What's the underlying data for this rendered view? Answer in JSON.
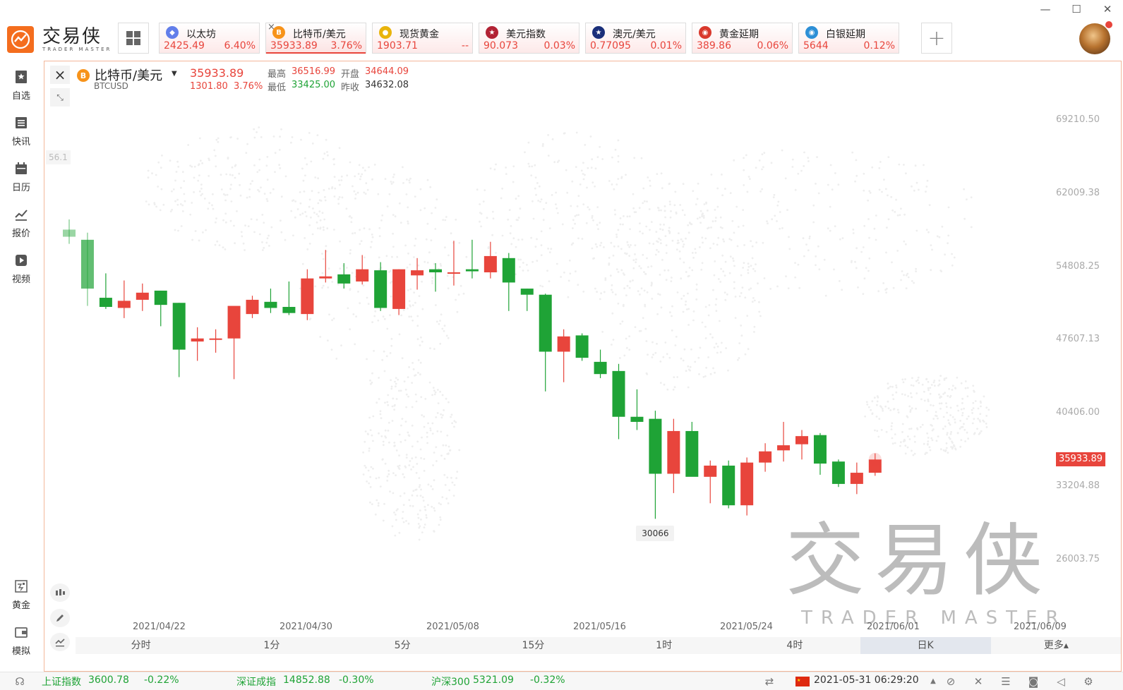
{
  "app": {
    "name_cn": "交易侠",
    "name_en": "TRADER MASTER"
  },
  "window": {
    "minimize": "—",
    "maximize": "☐",
    "close": "✕"
  },
  "quote_tabs": [
    {
      "name": "以太坊",
      "price": "2425.49",
      "change": "6.40%",
      "icon": "ethereum-icon",
      "color": "#627eea",
      "glyph": "◆"
    },
    {
      "name": "比特币/美元",
      "price": "35933.89",
      "change": "3.76%",
      "icon": "bitcoin-icon",
      "color": "#f7931a",
      "glyph": "B",
      "active": true
    },
    {
      "name": "现货黄金",
      "price": "1903.71",
      "change": "--",
      "icon": "gold-icon",
      "color": "#e9b40c",
      "glyph": "●"
    },
    {
      "name": "美元指数",
      "price": "90.073",
      "change": "0.03%",
      "icon": "us-flag-icon",
      "color": "#b22234",
      "glyph": "★"
    },
    {
      "name": "澳元/美元",
      "price": "0.77095",
      "change": "0.01%",
      "icon": "au-flag-icon",
      "color": "#1a2f7a",
      "glyph": "★"
    },
    {
      "name": "黄金延期",
      "price": "389.86",
      "change": "0.06%",
      "icon": "gold-deferred-icon",
      "color": "#d9382c",
      "glyph": "◉"
    },
    {
      "name": "白银延期",
      "price": "5644",
      "change": "0.12%",
      "icon": "silver-deferred-icon",
      "color": "#2d8fd6",
      "glyph": "◉"
    }
  ],
  "sidebar": {
    "items": [
      {
        "label": "自选",
        "icon": "watchlist-icon"
      },
      {
        "label": "快讯",
        "icon": "news-icon"
      },
      {
        "label": "日历",
        "icon": "calendar-icon"
      },
      {
        "label": "报价",
        "icon": "quotes-icon"
      },
      {
        "label": "视频",
        "icon": "video-icon"
      }
    ],
    "bottom_items": [
      {
        "label": "黄金",
        "icon": "gold-tool-icon"
      },
      {
        "label": "模拟",
        "icon": "simulate-icon"
      }
    ]
  },
  "symbol": {
    "name": "比特币/美元",
    "code": "BTCUSD",
    "price": "35933.89",
    "change": "1301.80",
    "change_pct": "3.76%",
    "high_label": "最高",
    "high": "36516.99",
    "low_label": "最低",
    "low": "33425.00",
    "open_label": "开盘",
    "open": "34644.09",
    "prev_close_label": "昨收",
    "prev_close": "34632.08"
  },
  "chart_data": {
    "type": "candlestick",
    "y_ticks": [
      "69210.50",
      "62009.38",
      "54808.25",
      "47607.13",
      "40406.00",
      "33204.88",
      "26003.75"
    ],
    "y_tick_values": [
      69210.5,
      62009.38,
      54808.25,
      47607.13,
      40406.0,
      33204.88,
      26003.75
    ],
    "x_ticks": [
      "2021/04/22",
      "2021/04/30",
      "2021/05/08",
      "2021/05/16",
      "2021/05/24",
      "2021/06/01",
      "2021/06/09"
    ],
    "last_price_label": "35933.89",
    "low_marker_label": "30066",
    "left_marker_label": "56.1",
    "candles": [
      {
        "o": 58500,
        "h": 59500,
        "l": 57100,
        "c": 57800
      },
      {
        "o": 57500,
        "h": 58200,
        "l": 51000,
        "c": 52700
      },
      {
        "o": 51800,
        "h": 54200,
        "l": 50700,
        "c": 50900
      },
      {
        "o": 50800,
        "h": 53500,
        "l": 49800,
        "c": 51500
      },
      {
        "o": 51600,
        "h": 53200,
        "l": 50500,
        "c": 52300
      },
      {
        "o": 52500,
        "h": 52500,
        "l": 49000,
        "c": 51100
      },
      {
        "o": 51300,
        "h": 51300,
        "l": 44000,
        "c": 46700
      },
      {
        "o": 47500,
        "h": 48900,
        "l": 45600,
        "c": 47800
      },
      {
        "o": 47700,
        "h": 48700,
        "l": 46400,
        "c": 47800
      },
      {
        "o": 47800,
        "h": 50400,
        "l": 43800,
        "c": 51000
      },
      {
        "o": 50200,
        "h": 52000,
        "l": 49800,
        "c": 51600
      },
      {
        "o": 51400,
        "h": 52700,
        "l": 50300,
        "c": 50800
      },
      {
        "o": 50900,
        "h": 53400,
        "l": 50100,
        "c": 50300
      },
      {
        "o": 50200,
        "h": 54600,
        "l": 49600,
        "c": 53700
      },
      {
        "o": 53700,
        "h": 56500,
        "l": 53300,
        "c": 53900
      },
      {
        "o": 54100,
        "h": 55200,
        "l": 52700,
        "c": 53200
      },
      {
        "o": 53400,
        "h": 56000,
        "l": 53100,
        "c": 54600
      },
      {
        "o": 54500,
        "h": 55300,
        "l": 50500,
        "c": 50800
      },
      {
        "o": 50700,
        "h": 54600,
        "l": 50100,
        "c": 54600
      },
      {
        "o": 54000,
        "h": 55700,
        "l": 52600,
        "c": 54500
      },
      {
        "o": 54600,
        "h": 55200,
        "l": 52400,
        "c": 54300
      },
      {
        "o": 54200,
        "h": 57400,
        "l": 53000,
        "c": 54300
      },
      {
        "o": 54600,
        "h": 57500,
        "l": 53700,
        "c": 54400
      },
      {
        "o": 54300,
        "h": 57300,
        "l": 53700,
        "c": 55900
      },
      {
        "o": 55700,
        "h": 56200,
        "l": 50500,
        "c": 53300
      },
      {
        "o": 52700,
        "h": 52700,
        "l": 50500,
        "c": 52100
      },
      {
        "o": 52100,
        "h": 52200,
        "l": 42600,
        "c": 46500
      },
      {
        "o": 46500,
        "h": 48700,
        "l": 43500,
        "c": 48000
      },
      {
        "o": 48100,
        "h": 48300,
        "l": 45600,
        "c": 45900
      },
      {
        "o": 45500,
        "h": 46700,
        "l": 43900,
        "c": 44300
      },
      {
        "o": 44600,
        "h": 45300,
        "l": 37900,
        "c": 40100
      },
      {
        "o": 40100,
        "h": 42800,
        "l": 38800,
        "c": 39600
      },
      {
        "o": 39900,
        "h": 40700,
        "l": 30066,
        "c": 34500
      },
      {
        "o": 34500,
        "h": 39900,
        "l": 32600,
        "c": 38700
      },
      {
        "o": 38700,
        "h": 39600,
        "l": 34700,
        "c": 34200
      },
      {
        "o": 34200,
        "h": 35800,
        "l": 31600,
        "c": 35300
      },
      {
        "o": 35300,
        "h": 35800,
        "l": 31100,
        "c": 31400
      },
      {
        "o": 31400,
        "h": 36100,
        "l": 30400,
        "c": 35600
      },
      {
        "o": 35600,
        "h": 37500,
        "l": 34700,
        "c": 36700
      },
      {
        "o": 36800,
        "h": 39600,
        "l": 35700,
        "c": 37300
      },
      {
        "o": 37400,
        "h": 38800,
        "l": 35900,
        "c": 38200
      },
      {
        "o": 38300,
        "h": 38500,
        "l": 34400,
        "c": 35500
      },
      {
        "o": 35700,
        "h": 35900,
        "l": 33200,
        "c": 33500
      },
      {
        "o": 33500,
        "h": 35600,
        "l": 32500,
        "c": 34600
      },
      {
        "o": 34600,
        "h": 36500,
        "l": 34300,
        "c": 35900
      }
    ]
  },
  "timeframes": [
    "分时",
    "1分",
    "5分",
    "15分",
    "1时",
    "4时",
    "日K",
    "更多▴"
  ],
  "timeframe_active": "日K",
  "status": {
    "idx1_name": "上证指数",
    "idx1_value": "3600.78",
    "idx1_change": "-0.22%",
    "idx2_name": "深证成指",
    "idx2_value": "14852.88",
    "idx2_change": "-0.30%",
    "idx3_name": "沪深300",
    "idx3_value": "5321.09",
    "idx3_change": "-0.32%",
    "datetime": "2021-05-31 06:29:20"
  },
  "colors": {
    "up": "#e8453c",
    "down": "#1fa336",
    "brand": "#f46d1e"
  }
}
